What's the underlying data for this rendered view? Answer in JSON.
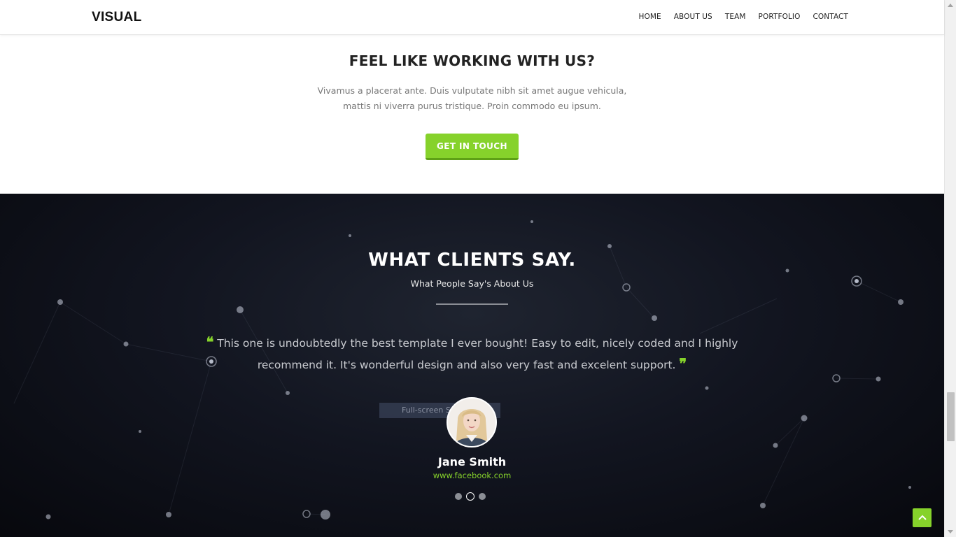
{
  "header": {
    "brand": "VISUAL",
    "nav": [
      "HOME",
      "ABOUT US",
      "TEAM",
      "PORTFOLIO",
      "CONTACT"
    ]
  },
  "cta": {
    "title": "FEEL LIKE WORKING WITH US?",
    "text": "Vivamus a placerat ante. Duis vulputate nibh sit amet augue vehicula, mattis ni viverra purus tristique. Proin commodo eu ipsum.",
    "button_label": "GET IN TOUCH"
  },
  "testimonials": {
    "title": "WHAT CLIENTS SAY.",
    "subtitle": "What People Say's About Us",
    "quote": "This one is undoubtedly the best template I ever bought! Easy to edit, nicely coded and I highly recommend it. It's wonderful design and also very fast and excelent support.",
    "overlay_tip": "Full-screen S",
    "client_name": "Jane Smith",
    "client_link": "www.facebook.com",
    "slides_total": 3,
    "active_slide": 2
  },
  "colors": {
    "accent": "#86d22b",
    "dark_bg": "#121520"
  },
  "icons": {
    "quote_open": "quote-open-icon",
    "quote_close": "quote-close-icon",
    "back_to_top": "chevron-up-icon"
  }
}
